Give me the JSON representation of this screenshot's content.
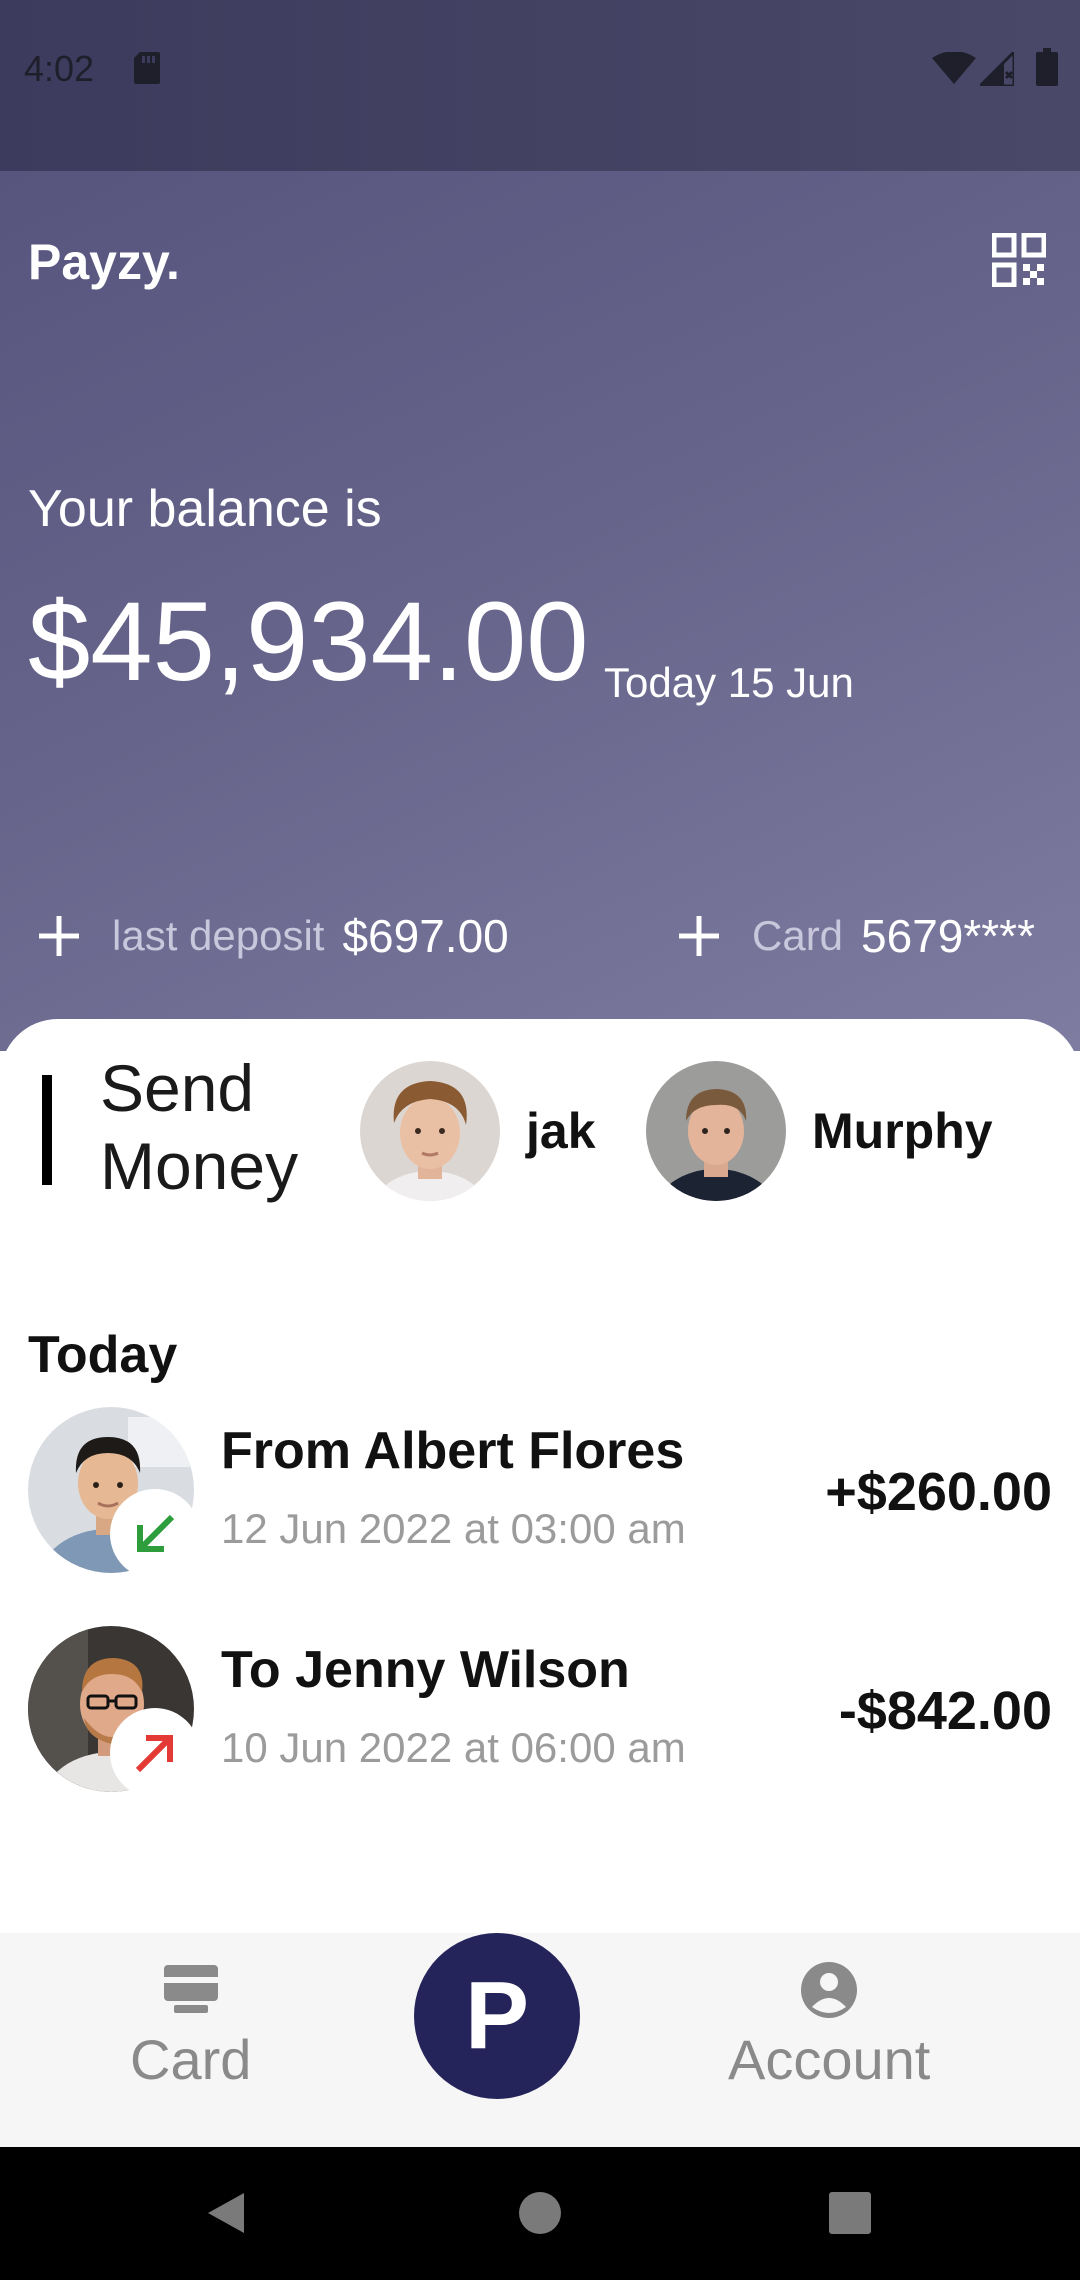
{
  "status_bar": {
    "time": "4:02"
  },
  "header": {
    "app_name": "Payzy.",
    "balance_label": "Your balance is",
    "balance_amount": "$45,934.00",
    "balance_date": "Today 15 Jun",
    "deposit_label": "last deposit",
    "deposit_value": "$697.00",
    "card_label": "Card",
    "card_value": "5679****"
  },
  "send_money": {
    "title": "Send Money",
    "contacts": [
      {
        "name": "jak"
      },
      {
        "name": "Murphy"
      }
    ]
  },
  "transactions": {
    "section_title": "Today",
    "items": [
      {
        "name": "From Albert Flores",
        "date": "12 Jun 2022 at 03:00 am",
        "amount": "+$260.00",
        "direction": "incoming",
        "badge_color": "#2e9e3c"
      },
      {
        "name": "To Jenny Wilson",
        "date": "10 Jun 2022 at 06:00 am",
        "amount": "-$842.00",
        "direction": "outgoing",
        "badge_color": "#e53935"
      }
    ]
  },
  "bottom_nav": {
    "card_label": "Card",
    "center_label": "P",
    "account_label": "Account"
  },
  "colors": {
    "header_gradient_start": "#57557e",
    "header_gradient_end": "#7e7ca0",
    "fab": "#25245a",
    "nav_background": "#f6f6f7"
  }
}
